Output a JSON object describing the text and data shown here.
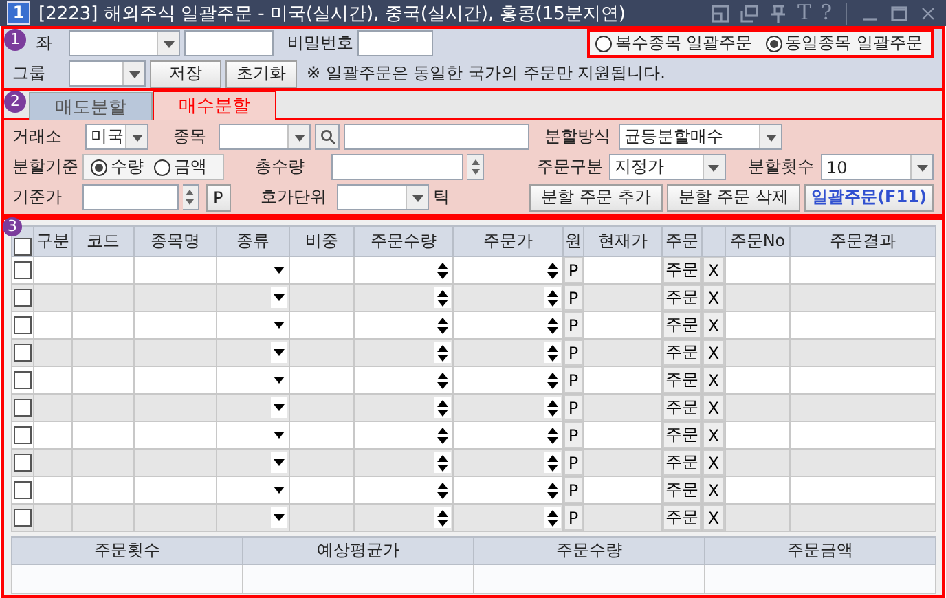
{
  "window": {
    "badge": "1",
    "title": "[2223] 해외주식 일괄주문 - 미국(실시간), 중국(실시간), 홍콩(15분지연)",
    "text_icons": [
      "T",
      "?"
    ]
  },
  "account_section": {
    "badge": "1",
    "account_label": "좌",
    "password_label": "비밀번호",
    "order_modes": [
      {
        "label": "복수종목 일괄주문",
        "selected": false
      },
      {
        "label": "동일종목 일괄주문",
        "selected": true
      }
    ],
    "group_label": "그룹",
    "buttons": [
      "저장",
      "초기화"
    ],
    "note": "※ 일괄주문은 동일한 국가의 주문만 지원됩니다."
  },
  "split_section": {
    "badge": "2",
    "tabs": [
      {
        "label": "매도분할",
        "selected": false
      },
      {
        "label": "매수분할",
        "selected": true
      }
    ],
    "exchange_label": "거래소",
    "exchange_value": "미국",
    "symbol_label": "종목",
    "split_method_label": "분할방식",
    "split_method_value": "균등분할매수",
    "basis_label": "분할기준",
    "basis_options": [
      {
        "label": "수량",
        "selected": true
      },
      {
        "label": "금액",
        "selected": false
      }
    ],
    "total_qty_label": "총수량",
    "order_type_label": "주문구분",
    "order_type_value": "지정가",
    "split_count_label": "분할횟수",
    "split_count_value": "10",
    "base_price_label": "기준가",
    "base_price_button": "P",
    "tick_unit_label": "호가단위",
    "tick_suffix": "틱",
    "buttons": [
      "분할 주문 추가",
      "분할 주문 삭제"
    ],
    "submit_button": "일괄주문(F11)"
  },
  "order_grid": {
    "badge": "3",
    "header_checked": false,
    "columns": [
      {
        "kind": "check"
      },
      {
        "label": "구분",
        "kind": "text"
      },
      {
        "label": "코드",
        "kind": "text"
      },
      {
        "label": "종목명",
        "kind": "text"
      },
      {
        "label": "종류",
        "kind": "combo"
      },
      {
        "label": "비중",
        "kind": "text"
      },
      {
        "label": "주문수량",
        "kind": "spin"
      },
      {
        "label": "주문가",
        "kind": "spin"
      },
      {
        "label": "원",
        "kind": "price"
      },
      {
        "label": "현재가",
        "kind": "text"
      },
      {
        "label": "주문",
        "kind": "order"
      },
      {
        "kind": "delete"
      },
      {
        "label": "주문No",
        "kind": "text"
      },
      {
        "label": "주문결과",
        "kind": "text"
      }
    ],
    "rows": [
      {
        "checked": false,
        "price_button": "P",
        "order_button": "주문",
        "delete_button": "X"
      },
      {
        "checked": false,
        "price_button": "P",
        "order_button": "주문",
        "delete_button": "X"
      },
      {
        "checked": false,
        "price_button": "P",
        "order_button": "주문",
        "delete_button": "X"
      },
      {
        "checked": false,
        "price_button": "P",
        "order_button": "주문",
        "delete_button": "X"
      },
      {
        "checked": false,
        "price_button": "P",
        "order_button": "주문",
        "delete_button": "X"
      },
      {
        "checked": false,
        "price_button": "P",
        "order_button": "주문",
        "delete_button": "X"
      },
      {
        "checked": false,
        "price_button": "P",
        "order_button": "주문",
        "delete_button": "X"
      },
      {
        "checked": false,
        "price_button": "P",
        "order_button": "주문",
        "delete_button": "X"
      },
      {
        "checked": false,
        "price_button": "P",
        "order_button": "주문",
        "delete_button": "X"
      },
      {
        "checked": false,
        "price_button": "P",
        "order_button": "주문",
        "delete_button": "X"
      }
    ]
  },
  "summary": {
    "columns": [
      "주문횟수",
      "예상평균가",
      "주문수량",
      "주문금액"
    ]
  }
}
